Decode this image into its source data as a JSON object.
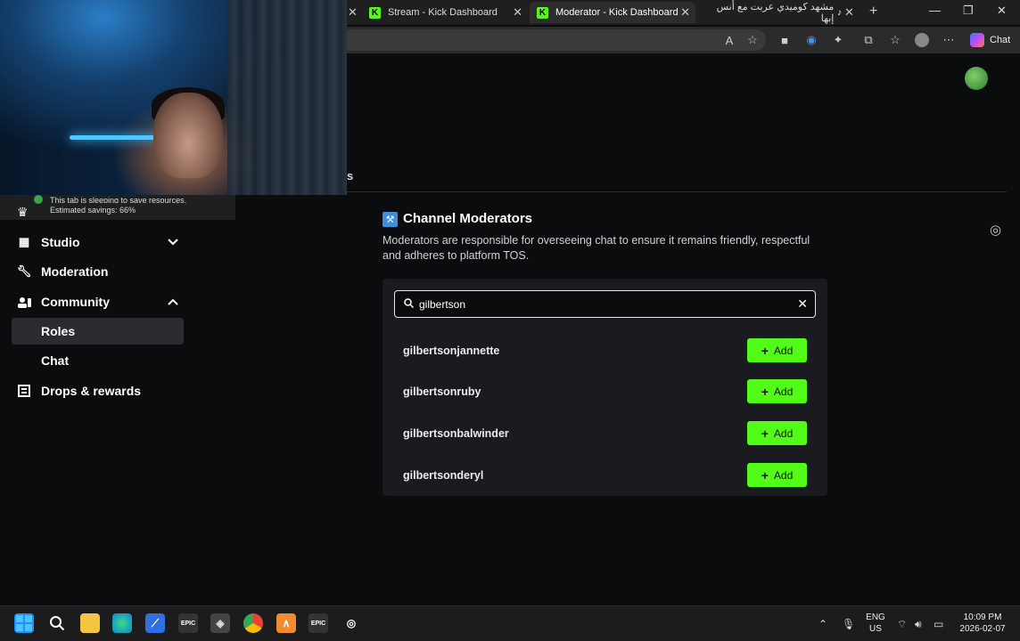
{
  "browser": {
    "tabs": [
      {
        "label": "Stream - Kick Dashboard",
        "favicon": "K"
      },
      {
        "label": "Moderator - Kick Dashboard",
        "favicon": "K"
      },
      {
        "label": "مشهد كوميدي عربت مع أنس إبها",
        "favicon": "♪"
      }
    ],
    "new_tab": "+",
    "chat_button": "Chat"
  },
  "sleeping_tab_notice": {
    "line1": "This tab is sleeping to save resources.",
    "line2": "Estimated savings: 66%"
  },
  "sidebar": {
    "items": [
      {
        "label": "Studio",
        "icon": "grid-icon",
        "chevron": "⌄"
      },
      {
        "label": "Moderation",
        "icon": "wrench-icon"
      },
      {
        "label": "Community",
        "icon": "people-icon",
        "chevron": "⌃"
      },
      {
        "label": "Roles"
      },
      {
        "label": "Chat"
      },
      {
        "label": "Drops & rewards",
        "icon": "gift-icon"
      }
    ]
  },
  "partial_heading": "s",
  "moderators": {
    "title": "Channel Moderators",
    "description": "Moderators are responsible for overseeing chat to ensure it remains friendly, respectful and adheres to platform TOS.",
    "search_value": "gilbertson",
    "add_label": "Add",
    "results": [
      "gilbertsonjannette",
      "gilbertsonruby",
      "gilbertsonbalwinder",
      "gilbertsonderyl"
    ]
  },
  "taskbar": {
    "lang_top": "ENG",
    "lang_bottom": "US",
    "time": "10:09 PM",
    "date": "2026-02-07"
  },
  "colors": {
    "accent": "#53fc18",
    "background": "#0b0c0d",
    "panel": "#191b1e"
  }
}
